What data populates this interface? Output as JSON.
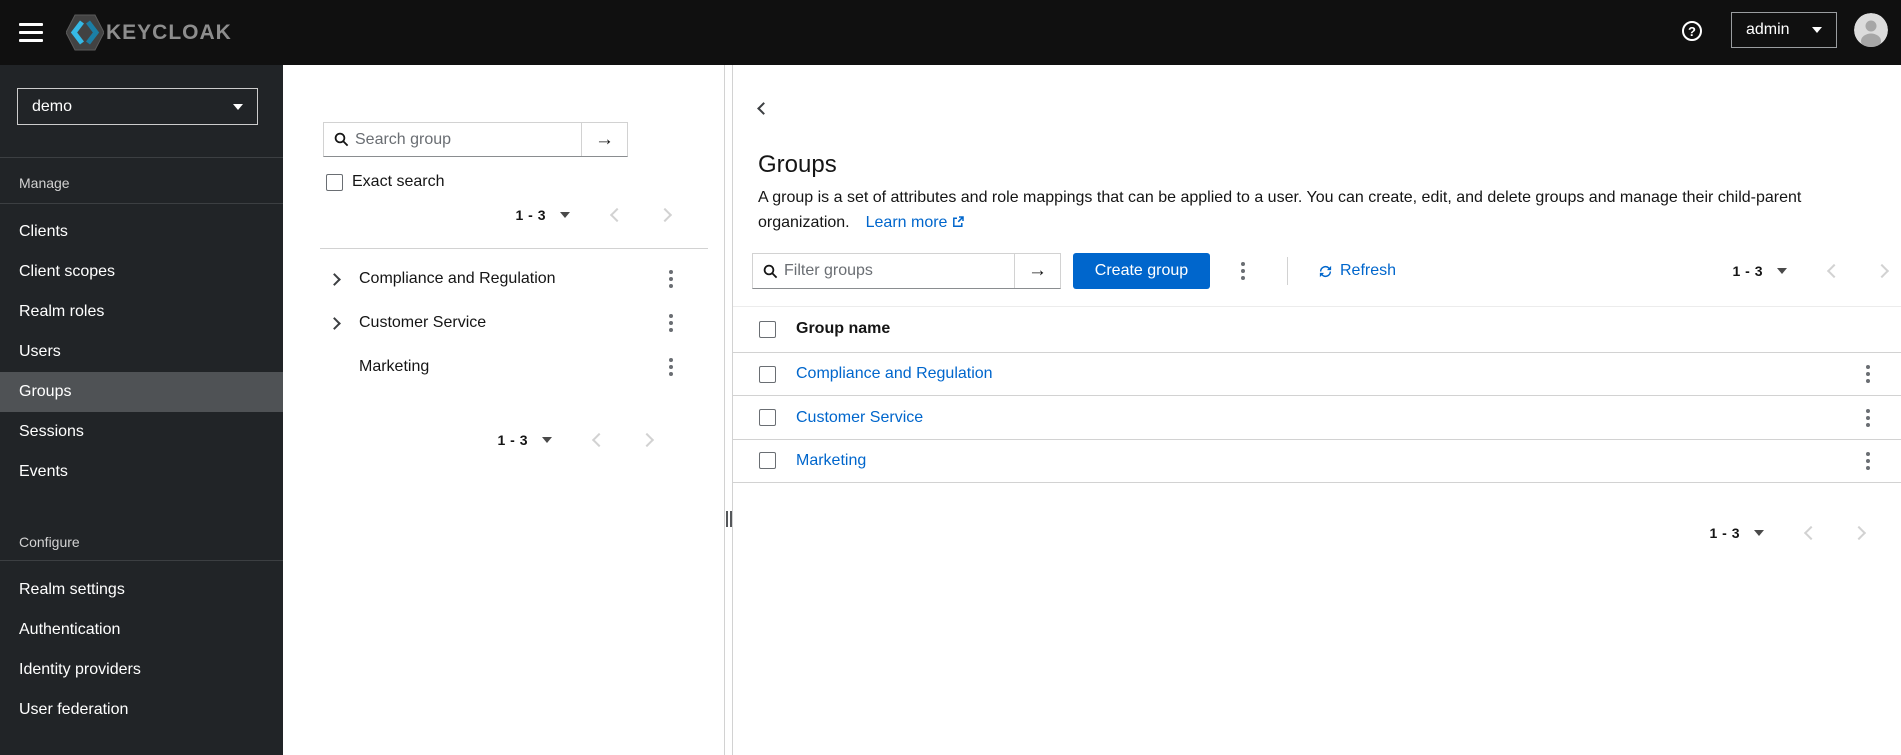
{
  "topbar": {
    "brand_text": "KEYCLOAK",
    "user_menu": {
      "label": "admin"
    }
  },
  "icons": {
    "arrow_right": "→",
    "help": "?"
  },
  "sidebar": {
    "realm_selector": {
      "value": "demo"
    },
    "sections": [
      {
        "label": "Manage",
        "items": [
          "Clients",
          "Client scopes",
          "Realm roles",
          "Users",
          "Groups",
          "Sessions",
          "Events"
        ]
      },
      {
        "label": "Configure",
        "items": [
          "Realm settings",
          "Authentication",
          "Identity providers",
          "User federation"
        ]
      }
    ],
    "active_item": "Groups"
  },
  "tree_panel": {
    "search": {
      "placeholder": "Search group"
    },
    "exact_search_label": "Exact search",
    "pagination_top": {
      "range": "1 - 3"
    },
    "pagination_bottom": {
      "range": "1 - 3"
    },
    "groups": [
      {
        "name": "Compliance and Regulation",
        "expandable": true
      },
      {
        "name": "Customer Service",
        "expandable": true
      },
      {
        "name": "Marketing",
        "expandable": false
      }
    ]
  },
  "main": {
    "title": "Groups",
    "description": "A group is a set of attributes and role mappings that can be applied to a user. You can create, edit, and delete groups and manage their child-parent organization.",
    "learn_more_label": "Learn more",
    "toolbar": {
      "filter": {
        "placeholder": "Filter groups"
      },
      "create_button_label": "Create group",
      "refresh_label": "Refresh",
      "pagination": {
        "range": "1 - 3"
      }
    },
    "table": {
      "columns": [
        "Group name"
      ],
      "rows": [
        {
          "name": "Compliance and Regulation"
        },
        {
          "name": "Customer Service"
        },
        {
          "name": "Marketing"
        }
      ]
    },
    "pagination_bottom": {
      "range": "1 - 3"
    }
  },
  "colors": {
    "primary": "#0066cc",
    "link": "#0066cc",
    "topbar_bg": "#101010",
    "sidebar_bg": "#212427",
    "sidebar_active_bg": "#4f5255",
    "border": "#d2d2d2",
    "text": "#151515",
    "muted": "#6a6e73",
    "brand_cyan": "#36b9e5"
  }
}
